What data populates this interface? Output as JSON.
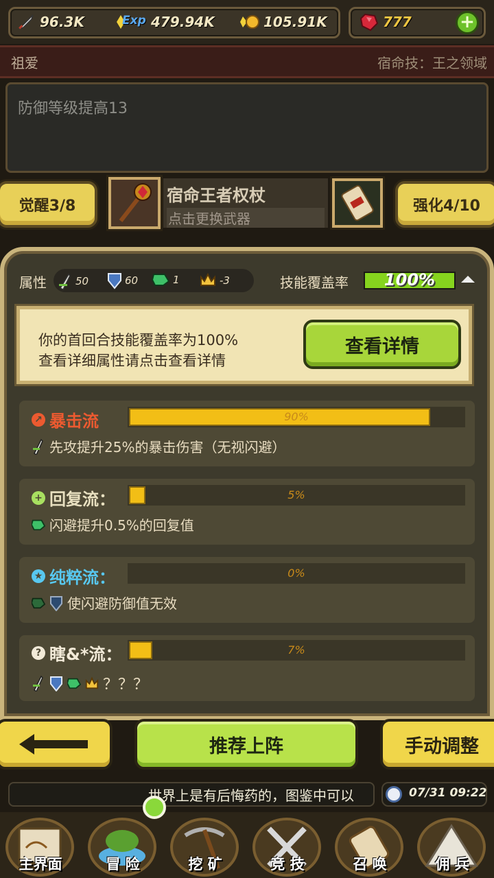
{
  "resources": {
    "attack": "96.3K",
    "exp": "479.94K",
    "gold": "105.91K",
    "gems": "777",
    "exp_icon_text": "Exp"
  },
  "hero": {
    "name": "祖爱",
    "fate_skill": "宿命技：王之领域",
    "description": "防御等级提高13"
  },
  "weapon": {
    "awaken_label": "觉醒3/8",
    "name": "宿命王者权杖",
    "hint": "点击更换武器",
    "enhance_label": "强化4/10"
  },
  "panel": {
    "attr_label": "属性",
    "attrs": [
      {
        "icon": "sword-icon",
        "value": "50"
      },
      {
        "icon": "shield-icon",
        "value": "60"
      },
      {
        "icon": "boot-icon",
        "value": "1"
      },
      {
        "icon": "crown-icon",
        "value": "-3"
      }
    ],
    "coverage_label": "技能覆盖率",
    "coverage_value": "100%",
    "coverage_fraction": 1.0,
    "info_line1": "你的首回合技能覆盖率为100%",
    "info_line2": "查看详细属性请点击查看详情",
    "detail_button": "查看详情"
  },
  "flows": [
    {
      "title": "暴击流",
      "icon": "crit-icon",
      "color": "#ec5a30",
      "percent_label": "90%",
      "fraction": 0.9,
      "desc": "先攻提升25%的暴击伤害（无视闪避）"
    },
    {
      "title": "回复流：",
      "icon": "plus-icon",
      "color": "#a8e060",
      "percent_label": "5%",
      "fraction": 0.05,
      "desc": "闪避提升0.5%的回复值"
    },
    {
      "title": "纯粹流：",
      "icon": "star-icon",
      "color": "#58c8f0",
      "percent_label": "0%",
      "fraction": 0.0,
      "desc": "使闪避防御值无效"
    },
    {
      "title": "瞎&*流：",
      "icon": "question-icon",
      "color": "#ffffff",
      "percent_label": "7%",
      "fraction": 0.07,
      "desc": "？？？"
    }
  ],
  "bottom": {
    "recommend": "推荐上阵",
    "manual": "手动调整",
    "marquee": "世界上是有后悔药的，图鉴中可以",
    "datetime": "07/31 09:22"
  },
  "nav": [
    "主界面",
    "冒 险",
    "挖 矿",
    "竞 技",
    "召 唤",
    "佣 兵"
  ]
}
